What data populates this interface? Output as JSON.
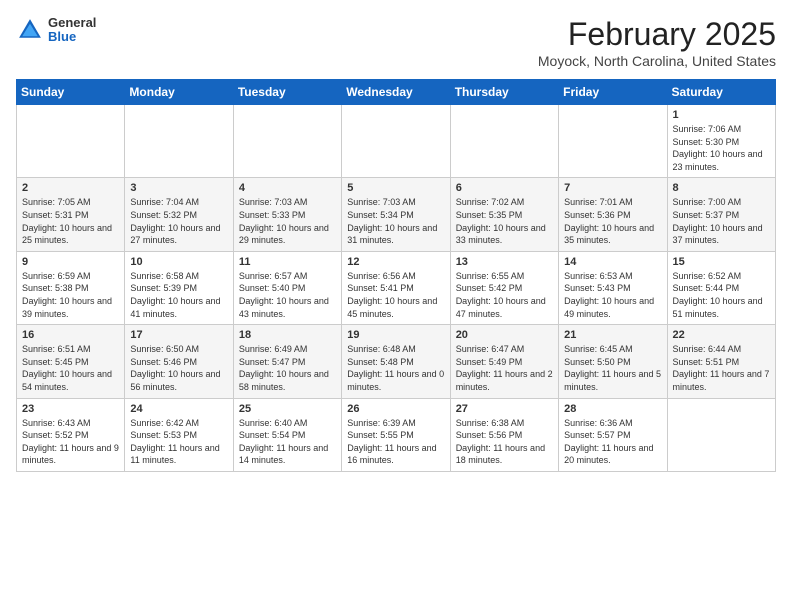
{
  "header": {
    "logo_general": "General",
    "logo_blue": "Blue",
    "title": "February 2025",
    "subtitle": "Moyock, North Carolina, United States"
  },
  "weekdays": [
    "Sunday",
    "Monday",
    "Tuesday",
    "Wednesday",
    "Thursday",
    "Friday",
    "Saturday"
  ],
  "weeks": [
    [
      {
        "day": "",
        "info": ""
      },
      {
        "day": "",
        "info": ""
      },
      {
        "day": "",
        "info": ""
      },
      {
        "day": "",
        "info": ""
      },
      {
        "day": "",
        "info": ""
      },
      {
        "day": "",
        "info": ""
      },
      {
        "day": "1",
        "info": "Sunrise: 7:06 AM\nSunset: 5:30 PM\nDaylight: 10 hours and 23 minutes."
      }
    ],
    [
      {
        "day": "2",
        "info": "Sunrise: 7:05 AM\nSunset: 5:31 PM\nDaylight: 10 hours and 25 minutes."
      },
      {
        "day": "3",
        "info": "Sunrise: 7:04 AM\nSunset: 5:32 PM\nDaylight: 10 hours and 27 minutes."
      },
      {
        "day": "4",
        "info": "Sunrise: 7:03 AM\nSunset: 5:33 PM\nDaylight: 10 hours and 29 minutes."
      },
      {
        "day": "5",
        "info": "Sunrise: 7:03 AM\nSunset: 5:34 PM\nDaylight: 10 hours and 31 minutes."
      },
      {
        "day": "6",
        "info": "Sunrise: 7:02 AM\nSunset: 5:35 PM\nDaylight: 10 hours and 33 minutes."
      },
      {
        "day": "7",
        "info": "Sunrise: 7:01 AM\nSunset: 5:36 PM\nDaylight: 10 hours and 35 minutes."
      },
      {
        "day": "8",
        "info": "Sunrise: 7:00 AM\nSunset: 5:37 PM\nDaylight: 10 hours and 37 minutes."
      }
    ],
    [
      {
        "day": "9",
        "info": "Sunrise: 6:59 AM\nSunset: 5:38 PM\nDaylight: 10 hours and 39 minutes."
      },
      {
        "day": "10",
        "info": "Sunrise: 6:58 AM\nSunset: 5:39 PM\nDaylight: 10 hours and 41 minutes."
      },
      {
        "day": "11",
        "info": "Sunrise: 6:57 AM\nSunset: 5:40 PM\nDaylight: 10 hours and 43 minutes."
      },
      {
        "day": "12",
        "info": "Sunrise: 6:56 AM\nSunset: 5:41 PM\nDaylight: 10 hours and 45 minutes."
      },
      {
        "day": "13",
        "info": "Sunrise: 6:55 AM\nSunset: 5:42 PM\nDaylight: 10 hours and 47 minutes."
      },
      {
        "day": "14",
        "info": "Sunrise: 6:53 AM\nSunset: 5:43 PM\nDaylight: 10 hours and 49 minutes."
      },
      {
        "day": "15",
        "info": "Sunrise: 6:52 AM\nSunset: 5:44 PM\nDaylight: 10 hours and 51 minutes."
      }
    ],
    [
      {
        "day": "16",
        "info": "Sunrise: 6:51 AM\nSunset: 5:45 PM\nDaylight: 10 hours and 54 minutes."
      },
      {
        "day": "17",
        "info": "Sunrise: 6:50 AM\nSunset: 5:46 PM\nDaylight: 10 hours and 56 minutes."
      },
      {
        "day": "18",
        "info": "Sunrise: 6:49 AM\nSunset: 5:47 PM\nDaylight: 10 hours and 58 minutes."
      },
      {
        "day": "19",
        "info": "Sunrise: 6:48 AM\nSunset: 5:48 PM\nDaylight: 11 hours and 0 minutes."
      },
      {
        "day": "20",
        "info": "Sunrise: 6:47 AM\nSunset: 5:49 PM\nDaylight: 11 hours and 2 minutes."
      },
      {
        "day": "21",
        "info": "Sunrise: 6:45 AM\nSunset: 5:50 PM\nDaylight: 11 hours and 5 minutes."
      },
      {
        "day": "22",
        "info": "Sunrise: 6:44 AM\nSunset: 5:51 PM\nDaylight: 11 hours and 7 minutes."
      }
    ],
    [
      {
        "day": "23",
        "info": "Sunrise: 6:43 AM\nSunset: 5:52 PM\nDaylight: 11 hours and 9 minutes."
      },
      {
        "day": "24",
        "info": "Sunrise: 6:42 AM\nSunset: 5:53 PM\nDaylight: 11 hours and 11 minutes."
      },
      {
        "day": "25",
        "info": "Sunrise: 6:40 AM\nSunset: 5:54 PM\nDaylight: 11 hours and 14 minutes."
      },
      {
        "day": "26",
        "info": "Sunrise: 6:39 AM\nSunset: 5:55 PM\nDaylight: 11 hours and 16 minutes."
      },
      {
        "day": "27",
        "info": "Sunrise: 6:38 AM\nSunset: 5:56 PM\nDaylight: 11 hours and 18 minutes."
      },
      {
        "day": "28",
        "info": "Sunrise: 6:36 AM\nSunset: 5:57 PM\nDaylight: 11 hours and 20 minutes."
      },
      {
        "day": "",
        "info": ""
      }
    ]
  ]
}
